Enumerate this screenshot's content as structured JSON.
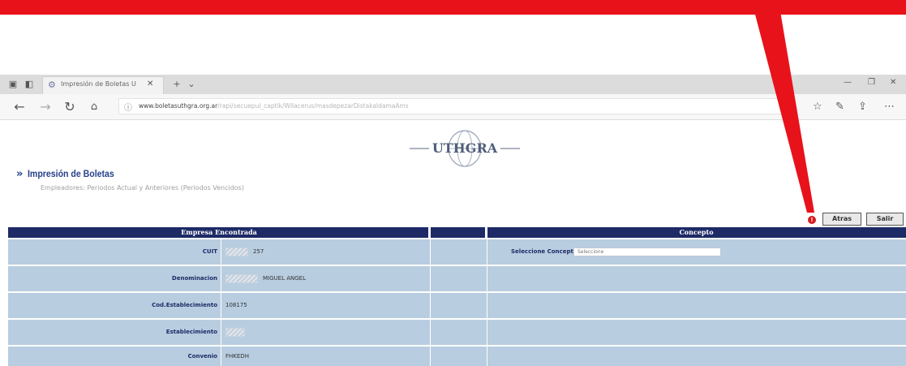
{
  "browser": {
    "tab_title": "Impresión de Boletas U",
    "url_main": "www.boletasuthgra.org.ar",
    "url_rest": "/rapi/secuepul_captik/Wllacerus/masdepezarDistakaldamaAms",
    "icons": [
      "tabs-icon",
      "back-tab-icon",
      "favicon-icon",
      "close-icon",
      "new-tab-icon",
      "chevron-down-icon",
      "minimize-icon",
      "restore-icon",
      "close-window-icon",
      "back-icon",
      "forward-icon",
      "refresh-icon",
      "home-icon",
      "info-icon",
      "reader-icon",
      "favorite-icon",
      "pen-icon",
      "share-icon",
      "more-icon"
    ]
  },
  "header": {
    "logo_text": "UTHGRA",
    "page_title": "Impresión de Boletas",
    "subtitle": "Empleadores: Periodos Actual y Anteriores (Periodos Vencidos)"
  },
  "actions": {
    "back_label": "Atras",
    "exit_label": "Salir"
  },
  "table": {
    "left_header": "Empresa Encontrada",
    "right_header": "Concepto",
    "rows": [
      {
        "label": "CUIT",
        "value": "257"
      },
      {
        "label": "Denominacion",
        "value": "MIGUEL ANGEL"
      },
      {
        "label": "Cod.Establecimiento",
        "value": "108175"
      },
      {
        "label": "Establecimiento",
        "value": ""
      },
      {
        "label": "Convenio",
        "value": "FHKEDH"
      }
    ],
    "concept_label": "Seleccione Concepto:",
    "concept_value": "Seleccione"
  },
  "colors": {
    "annotation_red": "#e8121b",
    "table_header": "#1d2a66",
    "row_bg": "#b8cde0",
    "title_blue": "#27408b"
  }
}
